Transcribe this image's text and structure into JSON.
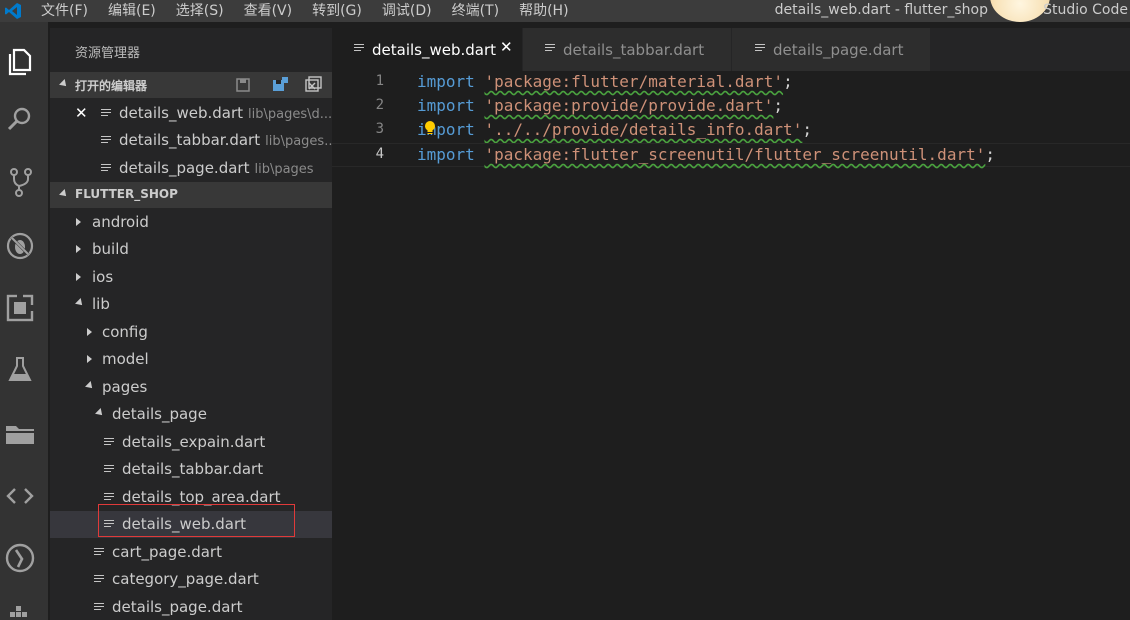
{
  "window": {
    "title": "details_web.dart - flutter_shop",
    "title_tail": "Studio Code"
  },
  "menu": [
    "文件(F)",
    "编辑(E)",
    "选择(S)",
    "查看(V)",
    "转到(G)",
    "调试(D)",
    "终端(T)",
    "帮助(H)"
  ],
  "activity_bar": [
    "explorer-icon",
    "search-icon",
    "source-control-icon",
    "debug-icon",
    "extensions-icon",
    "test-flask-icon",
    "folder-icon",
    "code-brackets-icon",
    "timeline-icon",
    "docker-icon"
  ],
  "sidebar": {
    "title": "资源管理器",
    "open_editors": {
      "header": "打开的编辑器",
      "items": [
        {
          "name": "details_web.dart",
          "desc": "lib\\pages\\d..."
        },
        {
          "name": "details_tabbar.dart",
          "desc": "lib\\pages..."
        },
        {
          "name": "details_page.dart",
          "desc": "lib\\pages"
        }
      ]
    },
    "project": {
      "header": "FLUTTER_SHOP",
      "items": [
        {
          "name": "android"
        },
        {
          "name": "build"
        },
        {
          "name": "ios"
        },
        {
          "name": "lib"
        },
        {
          "name": "config"
        },
        {
          "name": "model"
        },
        {
          "name": "pages"
        },
        {
          "name": "details_page"
        },
        {
          "name": "details_expain.dart"
        },
        {
          "name": "details_tabbar.dart"
        },
        {
          "name": "details_top_area.dart"
        },
        {
          "name": "details_web.dart"
        },
        {
          "name": "cart_page.dart"
        },
        {
          "name": "category_page.dart"
        },
        {
          "name": "details_page.dart"
        }
      ]
    }
  },
  "tabs": [
    {
      "label": "details_web.dart",
      "active": true
    },
    {
      "label": "details_tabbar.dart",
      "active": false
    },
    {
      "label": "details_page.dart",
      "active": false
    }
  ],
  "editor": {
    "lines": [
      {
        "num": "1",
        "keyword": "import",
        "string": "'package:flutter/material.dart'",
        "end": ";"
      },
      {
        "num": "2",
        "keyword": "import",
        "string": "'package:provide/provide.dart'",
        "end": ";"
      },
      {
        "num": "3",
        "keyword": "import",
        "string": "'../../provide/details_info.dart'",
        "end": ";"
      },
      {
        "num": "4",
        "keyword": "import",
        "string": "'package:flutter_screenutil/flutter_screenutil.dart'",
        "end": ";"
      }
    ]
  },
  "colors": {
    "keyword": "#569cd6",
    "string": "#ce9178",
    "highlight_box": "#e03a3a",
    "vscode_blue": "#007acc"
  }
}
